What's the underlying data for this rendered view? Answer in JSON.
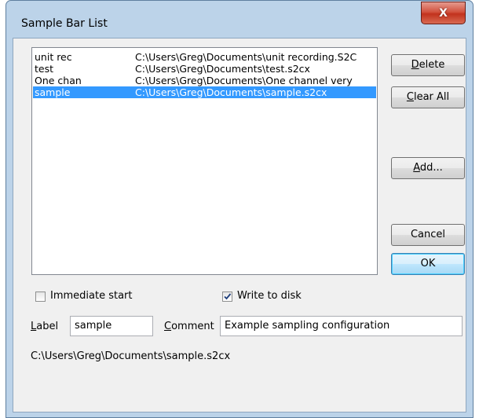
{
  "window": {
    "title": "Sample Bar List",
    "close_glyph": "X"
  },
  "list": {
    "rows": [
      {
        "name": "unit rec",
        "path": "C:\\Users\\Greg\\Documents\\unit recording.S2C",
        "selected": false
      },
      {
        "name": "test",
        "path": "C:\\Users\\Greg\\Documents\\test.s2cx",
        "selected": false
      },
      {
        "name": "One chan",
        "path": "C:\\Users\\Greg\\Documents\\One channel very",
        "selected": false
      },
      {
        "name": "sample",
        "path": "C:\\Users\\Greg\\Documents\\sample.s2cx",
        "selected": true
      }
    ]
  },
  "buttons": {
    "delete_first": "D",
    "delete_rest": "elete",
    "clear_first": "C",
    "clear_rest": "lear All",
    "add_first": "A",
    "add_rest": "dd...",
    "cancel": "Cancel",
    "ok": "OK"
  },
  "options": {
    "immediate_start": {
      "label": "Immediate start",
      "checked": false
    },
    "write_to_disk": {
      "label": "Write to disk",
      "checked": true
    }
  },
  "fields": {
    "label_first": "L",
    "label_rest": "abel",
    "label_value": "sample",
    "comment_first": "C",
    "comment_rest": "omment",
    "comment_value": "Example sampling configuration"
  },
  "path_display": "C:\\Users\\Greg\\Documents\\sample.s2cx",
  "colors": {
    "selection": "#3399ff",
    "frame": "#bcd3e9",
    "close_button": "#c7402b"
  }
}
